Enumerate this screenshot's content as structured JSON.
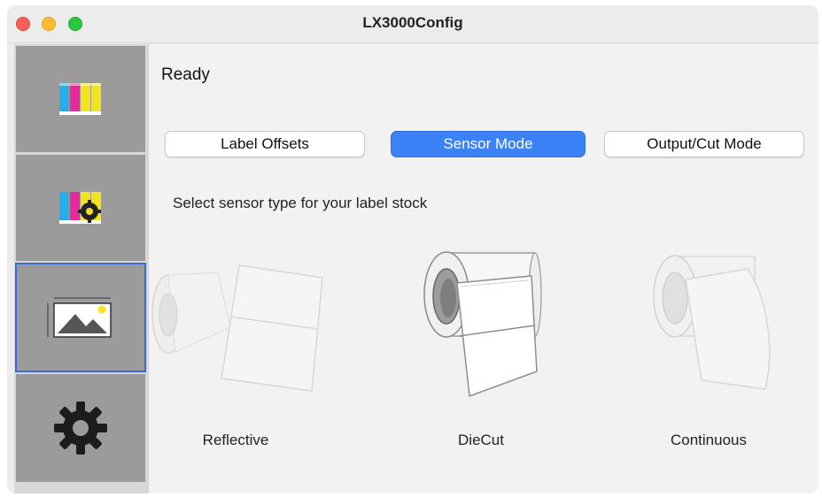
{
  "window": {
    "title": "LX3000Config"
  },
  "status": "Ready",
  "tabs": [
    {
      "label": "Label Offsets",
      "active": false
    },
    {
      "label": "Sensor Mode",
      "active": true
    },
    {
      "label": "Output/Cut Mode",
      "active": false
    }
  ],
  "instruction": "Select sensor type for your label stock",
  "sensors": [
    {
      "label": "Reflective",
      "selected": false,
      "icon": "reflective-label-roll-icon"
    },
    {
      "label": "DieCut",
      "selected": true,
      "icon": "diecut-label-roll-icon"
    },
    {
      "label": "Continuous",
      "selected": false,
      "icon": "continuous-roll-icon"
    }
  ],
  "sidebar": {
    "items": [
      {
        "icon": "ink-cartridges-icon",
        "selected": false
      },
      {
        "icon": "ink-settings-icon",
        "selected": false
      },
      {
        "icon": "label-image-icon",
        "selected": true
      },
      {
        "icon": "gear-icon",
        "selected": false
      }
    ]
  },
  "colors": {
    "accent": "#3b82f6",
    "sidebar_tile": "#9b9b9b",
    "selected_outline": "#3a6cd6"
  }
}
